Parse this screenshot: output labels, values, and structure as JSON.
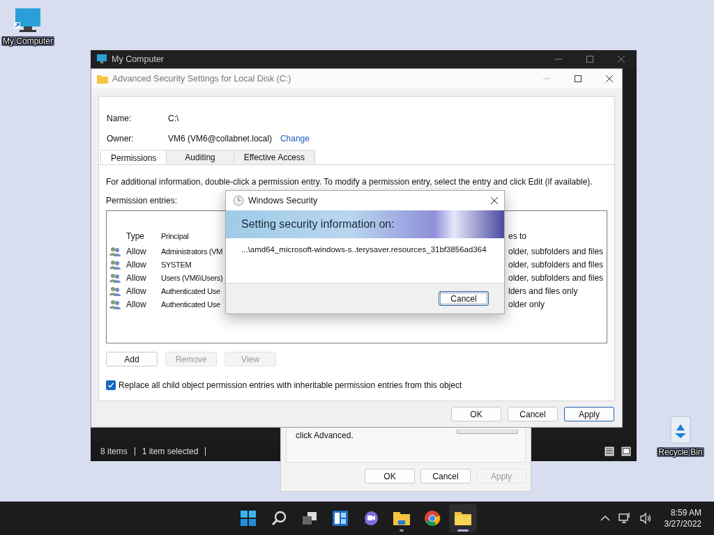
{
  "desktop_icons": [
    {
      "kind": "computer",
      "label": "My Computer"
    },
    {
      "kind": "recycle",
      "label": "Recycle Bin"
    }
  ],
  "explorer_window": {
    "title": "My Computer",
    "status_bar": [
      "8 items",
      "1 item selected"
    ]
  },
  "properties_window": {
    "text": "click Advanced.",
    "buttons": [
      {
        "label": "OK",
        "disabled": false
      },
      {
        "label": "Cancel",
        "disabled": false
      },
      {
        "label": "Apply",
        "disabled": true
      }
    ]
  },
  "advanced_window": {
    "title": "Advanced Security Settings for Local Disk (C:)",
    "name_label": "Name:",
    "name": "C:\\",
    "owner_label": "Owner:",
    "owner": "VM6 (VM6@collabnet.local)",
    "change_link": "Change",
    "tabs": [
      {
        "label": "Permissions",
        "selected": true
      },
      {
        "label": "Auditing",
        "selected": false
      },
      {
        "label": "Effective Access",
        "selected": false
      }
    ],
    "info": "For additional information, double-click a permission entry. To modify a permission entry, select the entry and click Edit (if available).",
    "entries_label": "Permission entries:",
    "columns": [
      "Type",
      "Principal",
      "es to"
    ],
    "rows": [
      {
        "type": "Allow",
        "principal": "Administrators (VM",
        "applies_to": "older, subfolders and files"
      },
      {
        "type": "Allow",
        "principal": "SYSTEM",
        "applies_to": "older, subfolders and files"
      },
      {
        "type": "Allow",
        "principal": "Users (VM6\\Users)",
        "applies_to": "older, subfolders and files"
      },
      {
        "type": "Allow",
        "principal": "Authenticated Use",
        "applies_to": "lders and files only"
      },
      {
        "type": "Allow",
        "principal": "Authenticated Use",
        "applies_to": "older only"
      }
    ],
    "entry_buttons": [
      {
        "label": "Add",
        "disabled": false
      },
      {
        "label": "Remove",
        "disabled": true
      },
      {
        "label": "View",
        "disabled": true
      }
    ],
    "replace_checkbox": {
      "label": "Replace all child object permission entries with inheritable permission entries from this object",
      "checked": true
    },
    "buttons": [
      {
        "label": "OK",
        "default": false
      },
      {
        "label": "Cancel",
        "default": false
      },
      {
        "label": "Apply",
        "default": true
      }
    ]
  },
  "security_dialog": {
    "title": "Windows Security",
    "heading": "Setting security information on:",
    "path": "...\\amd64_microsoft-windows-s..terysaver.resources_31bf3856ad364",
    "button": "Cancel"
  },
  "taskbar": {
    "apps": [
      {
        "kind": "start",
        "running": false,
        "active": false
      },
      {
        "kind": "search",
        "running": false,
        "active": false
      },
      {
        "kind": "taskview",
        "running": false,
        "active": false
      },
      {
        "kind": "widgets",
        "running": false,
        "active": false
      },
      {
        "kind": "chat",
        "running": false,
        "active": false
      },
      {
        "kind": "explorer",
        "running": true,
        "active": false
      },
      {
        "kind": "chrome",
        "running": false,
        "active": false
      },
      {
        "kind": "folder",
        "running": true,
        "active": true
      }
    ],
    "time": "8:59 AM",
    "date": "3/27/2022"
  }
}
